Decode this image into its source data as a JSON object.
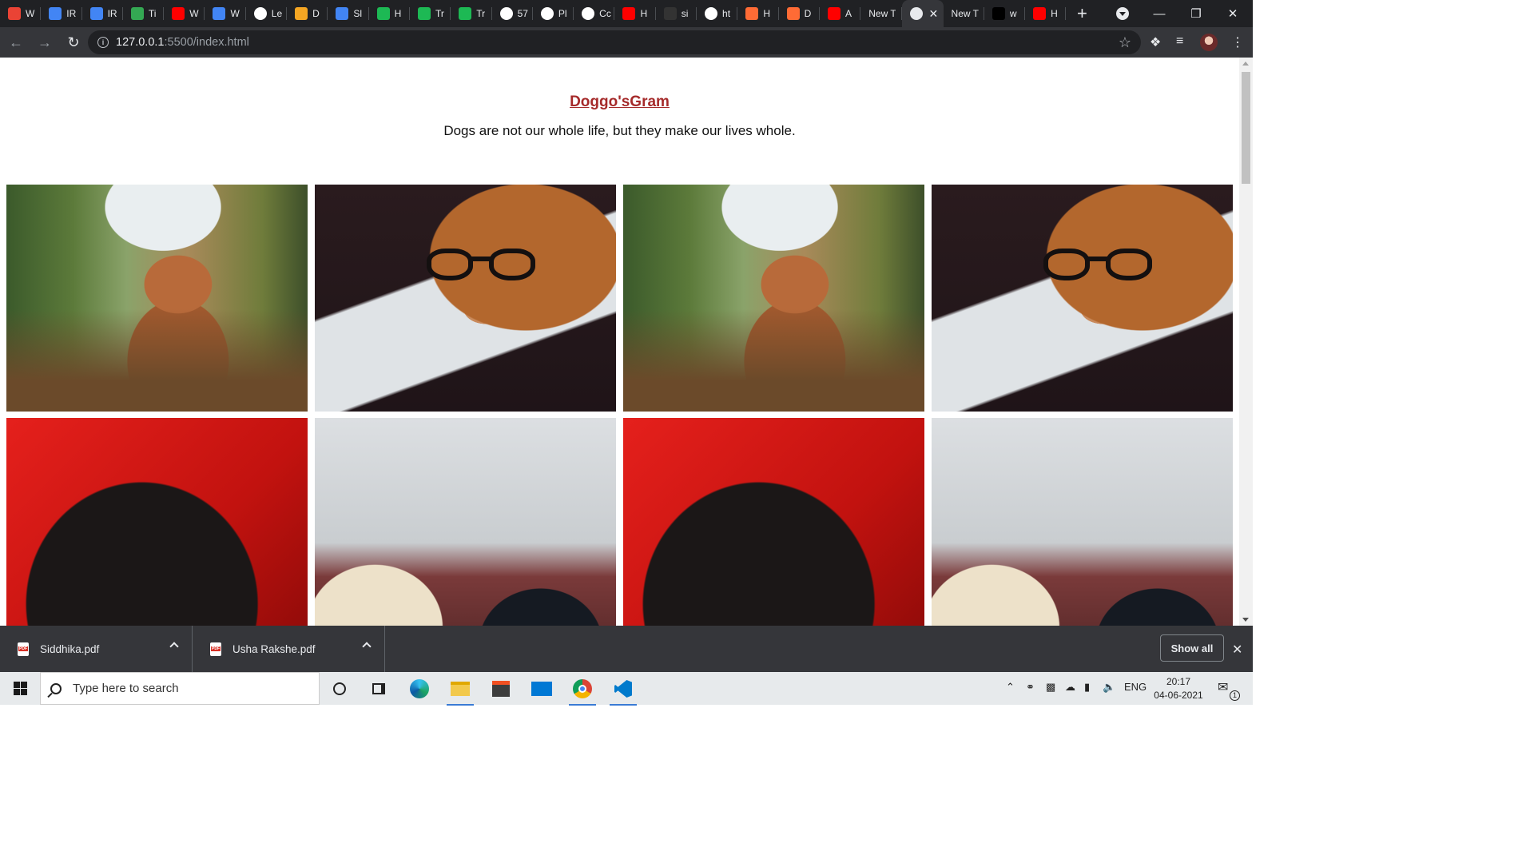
{
  "browser": {
    "tabs": [
      {
        "label": "W",
        "fav": "gmail-icon",
        "color": "#ea4335"
      },
      {
        "label": "IR",
        "fav": "ir-icon",
        "color": "#4285f4"
      },
      {
        "label": "IR",
        "fav": "ir-icon",
        "color": "#4285f4"
      },
      {
        "label": "Ti",
        "fav": "tinkercad-icon",
        "color": "#34a853"
      },
      {
        "label": "W",
        "fav": "youtube-icon",
        "color": "#ff0000"
      },
      {
        "label": "W",
        "fav": "docs-icon",
        "color": "#4285f4"
      },
      {
        "label": "Le",
        "fav": "google-icon",
        "color": "#ffffff"
      },
      {
        "label": "D",
        "fav": "dev-icon",
        "color": "#f5a623"
      },
      {
        "label": "Sl",
        "fav": "docs-icon",
        "color": "#4285f4"
      },
      {
        "label": "H",
        "fav": "w-icon",
        "color": "#1db954"
      },
      {
        "label": "Tr",
        "fav": "w-icon",
        "color": "#1db954"
      },
      {
        "label": "Tr",
        "fav": "w-icon",
        "color": "#1db954"
      },
      {
        "label": "57",
        "fav": "f-icon",
        "color": "#ffffff"
      },
      {
        "label": "Pl",
        "fav": "codepen-icon",
        "color": "#ffffff"
      },
      {
        "label": "Cc",
        "fav": "codepen-icon",
        "color": "#ffffff"
      },
      {
        "label": "H",
        "fav": "youtube-icon",
        "color": "#ff0000"
      },
      {
        "label": "si",
        "fav": "github-icon",
        "color": "#333333"
      },
      {
        "label": "ht",
        "fav": "google-icon",
        "color": "#ffffff"
      },
      {
        "label": "H",
        "fav": "hashnode-icon",
        "color": "#ff6b35"
      },
      {
        "label": "D",
        "fav": "hashnode-icon",
        "color": "#ff6b35"
      },
      {
        "label": "A",
        "fav": "youtube-icon",
        "color": "#ff0000"
      },
      {
        "label": "New T",
        "fav": "",
        "color": ""
      }
    ],
    "active_tab": {
      "fav": "globe-icon",
      "close": "✕"
    },
    "tabs_after": [
      {
        "label": "New T",
        "fav": "",
        "color": ""
      },
      {
        "label": "w",
        "fav": "w-icon-dark",
        "color": "#000000"
      },
      {
        "label": "H",
        "fav": "youtube-icon",
        "color": "#ff0000"
      }
    ],
    "new_tab": "+",
    "window_controls": {
      "minimize": "—",
      "restore": "❐",
      "close": "✕"
    },
    "url_host": "127.0.0.1",
    "url_rest": ":5500/index.html"
  },
  "page": {
    "title": "Doggo'sGram",
    "tagline": "Dogs are not our whole life, but they make our lives whole.",
    "photos": [
      "grass-dog",
      "glasses-dog",
      "grass-dog",
      "glasses-dog",
      "red-pug",
      "two-dogs",
      "red-pug",
      "two-dogs"
    ]
  },
  "downloads": {
    "items": [
      {
        "name": "Siddhika.pdf"
      },
      {
        "name": "Usha Rakshe.pdf"
      }
    ],
    "show_all": "Show all",
    "close": "✕"
  },
  "taskbar": {
    "search_placeholder": "Type here to search",
    "lang": "ENG",
    "time": "20:17",
    "date": "04-06-2021",
    "notification_count": "1"
  }
}
